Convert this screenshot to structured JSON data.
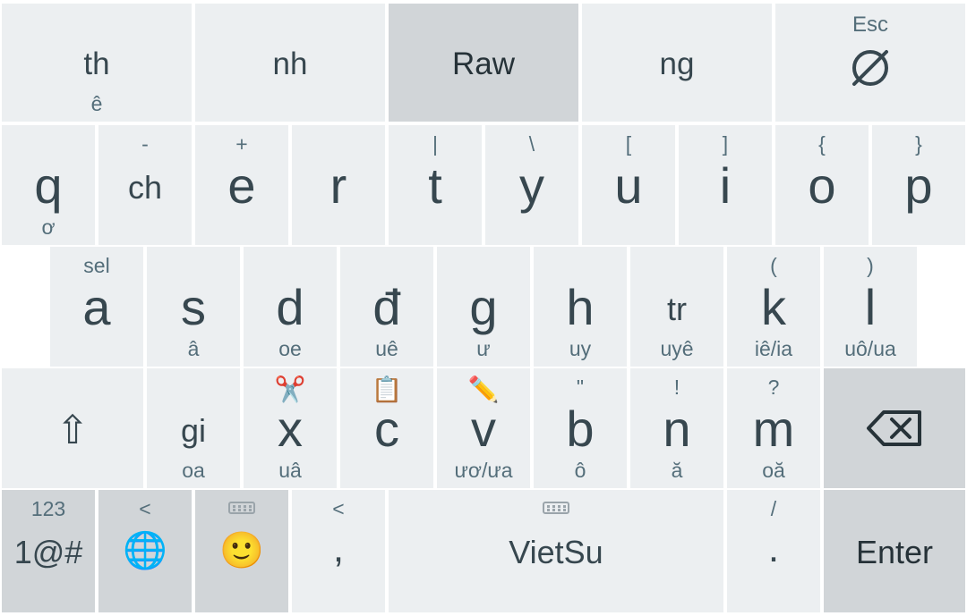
{
  "suggestions": [
    {
      "label": "th",
      "sub": "ê"
    },
    {
      "label": "nh",
      "sub": ""
    },
    {
      "label": "Raw",
      "sub": ""
    },
    {
      "label": "ng",
      "sub": ""
    },
    {
      "label": "Esc",
      "sub": ""
    }
  ],
  "row1": [
    {
      "main": "q",
      "top": "",
      "bottom": "ơ"
    },
    {
      "main": "ch",
      "top": "-",
      "bottom": ""
    },
    {
      "main": "e",
      "top": "+",
      "bottom": ""
    },
    {
      "main": "r",
      "top": "",
      "bottom": ""
    },
    {
      "main": "t",
      "top": "|",
      "bottom": ""
    },
    {
      "main": "y",
      "top": "\\",
      "bottom": ""
    },
    {
      "main": "u",
      "top": "[",
      "bottom": ""
    },
    {
      "main": "i",
      "top": "]",
      "bottom": ""
    },
    {
      "main": "o",
      "top": "{",
      "bottom": ""
    },
    {
      "main": "p",
      "top": "}",
      "bottom": ""
    }
  ],
  "row2": [
    {
      "main": "a",
      "top": "sel",
      "bottom": ""
    },
    {
      "main": "s",
      "top": "",
      "bottom": "â"
    },
    {
      "main": "d",
      "top": "",
      "bottom": "oe"
    },
    {
      "main": "đ",
      "top": "",
      "bottom": "uê"
    },
    {
      "main": "g",
      "top": "",
      "bottom": "ư"
    },
    {
      "main": "h",
      "top": "",
      "bottom": "uy"
    },
    {
      "main": "tr",
      "top": "",
      "bottom": "uyê"
    },
    {
      "main": "k",
      "top": "(",
      "bottom": "iê/ia"
    },
    {
      "main": "l",
      "top": ")",
      "bottom": "uô/ua"
    }
  ],
  "row3": [
    {
      "main": "gi",
      "top": "",
      "bottom": "oa"
    },
    {
      "main": "x",
      "top": "✂️",
      "bottom": "uâ"
    },
    {
      "main": "c",
      "top": "📋",
      "bottom": ""
    },
    {
      "main": "v",
      "top": "✏️",
      "bottom": "ươ/ưa"
    },
    {
      "main": "b",
      "top": "\"",
      "bottom": "ô"
    },
    {
      "main": "n",
      "top": "!",
      "bottom": "ă"
    },
    {
      "main": "m",
      "top": "?",
      "bottom": "oă"
    }
  ],
  "row3_shift": {
    "glyph": "⇧",
    "icon": "shift-icon"
  },
  "row3_backspace": {
    "icon": "backspace-icon"
  },
  "row4": {
    "symbols": {
      "main": "1@#",
      "top": "123"
    },
    "language": {
      "icon": "🌐",
      "top": "<"
    },
    "emoji": {
      "icon": "🙂"
    },
    "comma": {
      "main": ",",
      "top": "<"
    },
    "space": {
      "main": "VietSu"
    },
    "period": {
      "main": ".",
      "top": "/"
    },
    "enter": {
      "main": "Enter"
    }
  },
  "colors": {
    "key": "#eceff1",
    "dark_key": "#d1d5d8",
    "text": "#37474f",
    "hint": "#546e7a"
  }
}
